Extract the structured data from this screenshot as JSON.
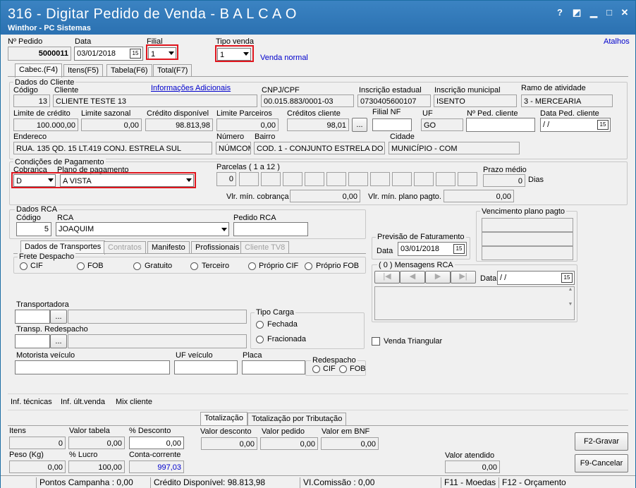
{
  "window": {
    "title": "316 - Digitar Pedido de Venda - B A L C A O",
    "subtitle": "Winthor - PC Sistemas",
    "help": "?",
    "btn_edit": "◩",
    "btn_min": "▁",
    "btn_max": "□",
    "btn_close": "✕"
  },
  "header": {
    "pedido_label": "Nº Pedido",
    "pedido_value": "5000011",
    "data_label": "Data",
    "data_value": "03/01/2018",
    "filial_label": "Filial",
    "filial_value": "1",
    "tipo_venda_label": "Tipo venda",
    "tipo_venda_value": "1",
    "tipo_venda_desc": "Venda normal",
    "atalhos": "Atalhos",
    "cal_icon": "15"
  },
  "tabs": [
    "Cabec.(F4)",
    "Itens(F5)",
    "Tabela(F6)",
    "Total(F7)"
  ],
  "cliente": {
    "group": "Dados do Cliente",
    "codigo_label": "Código",
    "codigo": "13",
    "cliente_label": "Cliente",
    "cliente": "CLIENTE TESTE 13",
    "info_link": "Informações Adicionais",
    "cnpj_label": "CNPJ/CPF",
    "cnpj": "00.015.883/0001-03",
    "ie_label": "Inscrição estadual",
    "ie": "0730405600107",
    "im_label": "Inscrição municipal",
    "im": "ISENTO",
    "ramo_label": "Ramo de atividade",
    "ramo": "3 - MERCEARIA",
    "limite_label": "Limite de crédito",
    "limite": "100.000,00",
    "sazonal_label": "Limite sazonal",
    "sazonal": "0,00",
    "credito_label": "Crédito disponível",
    "credito": "98.813,98",
    "parceiros_label": "Limite Parceiros",
    "parceiros": "0,00",
    "creditos_cli_label": "Créditos cliente",
    "creditos_cli": "98,01",
    "ellipsis": "...",
    "filial_nf_label": "Filial NF",
    "uf_label": "UF",
    "uf": "GO",
    "ped_cli_label": "Nº Ped. cliente",
    "data_ped_label": "Data Ped. cliente",
    "data_ped": "/ /",
    "endereco_label": "Endereco",
    "endereco": "RUA. 135 QD. 15 LT.419 CONJ. ESTRELA SUL",
    "numero_label": "Número",
    "numero": "NÚMCOM",
    "bairro_label": "Bairro",
    "bairro": "COD. 1 - CONJUNTO ESTRELA DO SU",
    "cidade_label": "Cidade",
    "cidade": "MUNICÍPIO - COM"
  },
  "pagamento": {
    "group": "Condições de Pagamento",
    "cobranca_label": "Cobranca",
    "cobranca": "D",
    "plano_label": "Plano de pagamento",
    "plano": "A VISTA",
    "parcelas_label": "Parcelas ( 1 a 12 )",
    "parcela1": "0",
    "prazo_label": "Prazo médio",
    "prazo": "0",
    "dias": "Dias",
    "vl_min_cob_label": "Vlr. mín. cobrança",
    "vl_min_cob": "0,00",
    "vl_min_plano_label": "Vlr. mín. plano pagto.",
    "vl_min_plano": "0,00"
  },
  "rca": {
    "group": "Dados RCA",
    "codigo_label": "Código",
    "codigo": "5",
    "rca_label": "RCA",
    "rca": "JOAQUIM",
    "pedido_rca_label": "Pedido RCA"
  },
  "vencimento_label": "Vencimento plano pagto",
  "previsao": {
    "group": "Previsão de Faturamento",
    "data_label": "Data",
    "data": "03/01/2018"
  },
  "mensagens": {
    "group": "( 0 ) Mensagens RCA",
    "data_label": "Data",
    "data": "/ /"
  },
  "subtabs": [
    "Dados de Transportes",
    "Contratos",
    "Manifesto",
    "Profissionais",
    "Cliente TV8"
  ],
  "transporte": {
    "frete_label": "Frete Despacho",
    "frete": [
      "CIF",
      "FOB",
      "Gratuito",
      "Terceiro",
      "Próprio CIF",
      "Próprio FOB"
    ],
    "transportadora_label": "Transportadora",
    "transp_redesp_label": "Transp. Redespacho",
    "tipo_carga_label": "Tipo Carga",
    "fechada": "Fechada",
    "fracionada": "Fracionada",
    "venda_triangular": "Venda Triangular",
    "motorista_label": "Motorista veículo",
    "uf_veiculo_label": "UF veículo",
    "placa_label": "Placa",
    "redespacho_label": "Redespacho",
    "red_cif": "CIF",
    "red_fob": "FOB"
  },
  "links": [
    "Inf. técnicas",
    "Inf. últ.venda",
    "Mix cliente"
  ],
  "total_tabs": [
    "Totalização",
    "Totalização por Tributação"
  ],
  "totais": {
    "itens_label": "Itens",
    "itens": "0",
    "valor_tabela_label": "Valor tabela",
    "valor_tabela": "0,00",
    "desc_label": "% Desconto",
    "desc": "0,00",
    "valor_desc_label": "Valor desconto",
    "valor_desc": "0,00",
    "valor_pedido_label": "Valor pedido",
    "valor_pedido": "0,00",
    "valor_bnf_label": "Valor em BNF",
    "valor_bnf": "0,00",
    "peso_label": "Peso (Kg)",
    "peso": "0,00",
    "lucro_label": "% Lucro",
    "lucro": "100,00",
    "cc_label": "Conta-corrente",
    "cc": "997,03",
    "valor_atendido_label": "Valor atendido",
    "valor_atendido": "0,00"
  },
  "buttons": {
    "gravar": "F2-Gravar",
    "cancelar": "F9-Cancelar"
  },
  "status": {
    "pontos": "Pontos Campanha : 0,00",
    "credito": "Crédito Disponível: 98.813,98",
    "comissao": "VI.Comissão : 0,00",
    "moedas": "F11 - Moedas",
    "orcamento": "F12 - Orçamento"
  },
  "colors": {
    "titlebar": "#2b71b1",
    "highlight": "#e0161e",
    "link": "#0000cc"
  }
}
